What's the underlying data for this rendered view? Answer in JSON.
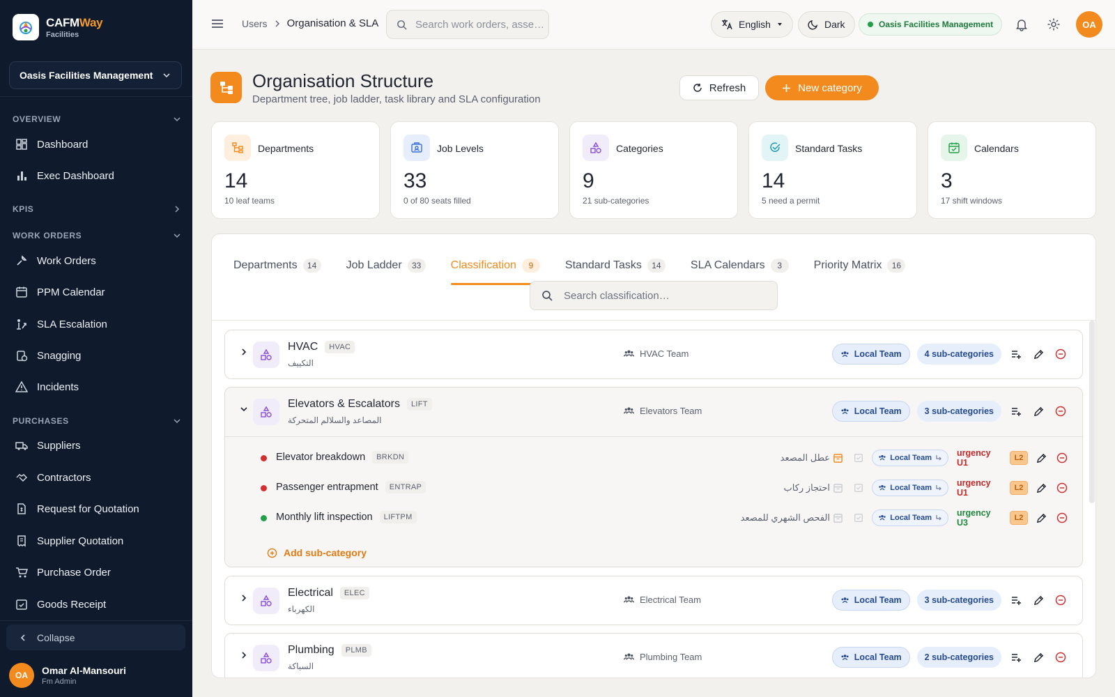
{
  "app": {
    "name_main": "CAFM",
    "name_accent": "Way",
    "sub": "Facilities"
  },
  "sidebar": {
    "org": "Oasis Facilities Management",
    "sections": {
      "overview": "OVERVIEW",
      "kpis": "KPIS",
      "work_orders": "WORK ORDERS",
      "purchases": "PURCHASES"
    },
    "items": {
      "dashboard": "Dashboard",
      "exec_dashboard": "Exec Dashboard",
      "work_orders": "Work Orders",
      "ppm_calendar": "PPM Calendar",
      "sla_escalation": "SLA Escalation",
      "snagging": "Snagging",
      "incidents": "Incidents",
      "suppliers": "Suppliers",
      "contractors": "Contractors",
      "rfq": "Request for Quotation",
      "supplier_quotation": "Supplier Quotation",
      "purchase_order": "Purchase Order",
      "goods_receipt": "Goods Receipt"
    },
    "collapse": "Collapse",
    "user": {
      "initials": "OA",
      "name": "Omar Al-Mansouri",
      "role": "Fm Admin"
    }
  },
  "topbar": {
    "breadcrumb_parent": "Users",
    "breadcrumb_current": "Organisation & SLA",
    "search_placeholder": "Search work orders, asse…",
    "language": "English",
    "theme": "Dark",
    "org": "Oasis Facilities Management",
    "avatar": "OA"
  },
  "header": {
    "title": "Organisation Structure",
    "subtitle": "Department tree, job ladder, task library and SLA configuration",
    "refresh": "Refresh",
    "new_category": "New category"
  },
  "stats": [
    {
      "label": "Departments",
      "value": "14",
      "sub": "10 leaf teams",
      "color": "#f28a1e"
    },
    {
      "label": "Job Levels",
      "value": "33",
      "sub": "0 of 80 seats filled",
      "color": "#3b6fd4"
    },
    {
      "label": "Categories",
      "value": "9",
      "sub": "21 sub-categories",
      "color": "#8a4fd6"
    },
    {
      "label": "Standard Tasks",
      "value": "14",
      "sub": "5 need a permit",
      "color": "#1f9bb0"
    },
    {
      "label": "Calendars",
      "value": "3",
      "sub": "17 shift windows",
      "color": "#22a048"
    }
  ],
  "tabs": [
    {
      "label": "Departments",
      "count": "14"
    },
    {
      "label": "Job Ladder",
      "count": "33"
    },
    {
      "label": "Classification",
      "count": "9"
    },
    {
      "label": "Standard Tasks",
      "count": "14"
    },
    {
      "label": "SLA Calendars",
      "count": "3"
    },
    {
      "label": "Priority Matrix",
      "count": "16"
    }
  ],
  "classification_search_placeholder": "Search classification…",
  "local_team": "Local Team",
  "categories": [
    {
      "name": "HVAC",
      "code": "HVAC",
      "arabic": "التكييف",
      "team": "HVAC Team",
      "subcount": "4 sub-categories"
    },
    {
      "name": "Elevators & Escalators",
      "code": "LIFT",
      "arabic": "المصاعد والسلالم المتحركة",
      "team": "Elevators Team",
      "subcount": "3 sub-categories"
    },
    {
      "name": "Electrical",
      "code": "ELEC",
      "arabic": "الكهرباء",
      "team": "Electrical Team",
      "subcount": "3 sub-categories"
    },
    {
      "name": "Plumbing",
      "code": "PLMB",
      "arabic": "السباكة",
      "team": "Plumbing Team",
      "subcount": "2 sub-categories"
    }
  ],
  "subcategories": [
    {
      "name": "Elevator breakdown",
      "code": "BRKDN",
      "arabic": "عطل المصعد",
      "urgency": "urgency U1",
      "level": "L2",
      "status_color": "#d32f2f",
      "urgency_color": "#c62828"
    },
    {
      "name": "Passenger entrapment",
      "code": "ENTRAP",
      "arabic": "احتجاز ركاب",
      "urgency": "urgency U1",
      "level": "L2",
      "status_color": "#d32f2f",
      "urgency_color": "#c62828"
    },
    {
      "name": "Monthly lift inspection",
      "code": "LIFTPM",
      "arabic": "الفحص الشهري للمصعد",
      "urgency": "urgency U3",
      "level": "L2",
      "status_color": "#22a048",
      "urgency_color": "#1e8a3c"
    }
  ],
  "add_subcategory": "Add sub-category"
}
